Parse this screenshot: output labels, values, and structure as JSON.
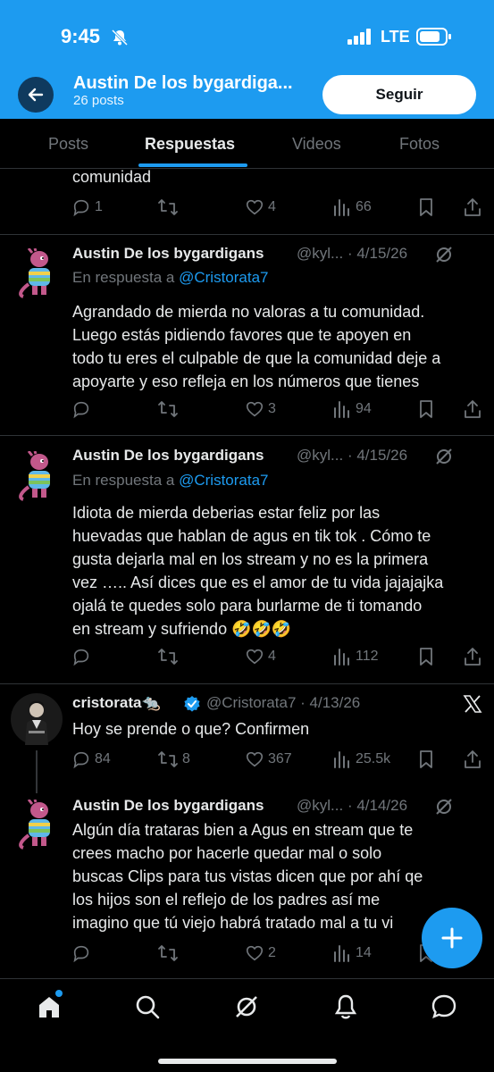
{
  "status_bar": {
    "time": "9:45",
    "network": "LTE"
  },
  "profile": {
    "name": "Austin De los bygardiga...",
    "posts": "26 posts",
    "follow_label": "Seguir"
  },
  "tabs": [
    {
      "label": "Posts"
    },
    {
      "label": "Respuestas",
      "active": true
    },
    {
      "label": "Videos"
    },
    {
      "label": "Fotos"
    }
  ],
  "partial_post": {
    "text": "comunidad",
    "replies": "1",
    "likes": "4",
    "views": "66"
  },
  "posts": [
    {
      "name": "Austin De los bygardigans",
      "handle": "@kyl...",
      "date": "· 4/15/26",
      "reply_prefix": "En respuesta a",
      "reply_to": "@Cristorata7",
      "lines": [
        "Agrandado de mierda no valoras a tu comunidad.",
        "Luego estás pidiendo favores que te apoyen en",
        "todo tu eres el culpable de que la comunidad deje a",
        "apoyarte y eso refleja en los números que tienes"
      ],
      "replies": "",
      "reposts": "",
      "likes": "3",
      "views": "94"
    },
    {
      "name": "Austin De los bygardigans",
      "handle": "@kyl...",
      "date": "· 4/15/26",
      "reply_prefix": "En respuesta a",
      "reply_to": "@Cristorata7",
      "lines": [
        "Idiota de mierda deberias estar feliz por las",
        "huevadas que hablan de agus en tik tok . Cómo te",
        "gusta dejarla mal en los stream y no es la primera",
        "vez ….. Así dices que es el amor de tu vida jajajajka",
        "ojalá te quedes solo para burlarme de ti tomando",
        "en stream y sufriendo 🤣🤣🤣"
      ],
      "replies": "",
      "reposts": "",
      "likes": "4",
      "views": "112"
    },
    {
      "name": "cristorata🐀",
      "handle": "@Cristorata7",
      "date": "· 4/13/26",
      "lines": [
        "Hoy se prende o que? Confirmen"
      ],
      "replies": "84",
      "reposts": "8",
      "likes": "367",
      "views": "25.5k"
    },
    {
      "name": "Austin De los bygardigans",
      "handle": "@kyl...",
      "date": "· 4/14/26",
      "lines": [
        "Algún día trataras bien a Agus en stream que te",
        "crees macho por hacerle quedar mal o solo",
        "buscas Clips para tus vistas dicen que por ahí qe",
        "los hijos son el reflejo de los padres así me",
        "imagino que tú viejo habrá tratado mal a tu vi"
      ],
      "replies": "",
      "reposts": "",
      "likes": "2",
      "views": "14"
    }
  ],
  "colors": {
    "accent": "#1d9bf0",
    "background": "#000000",
    "muted": "#71767b",
    "text": "#e7e9ea"
  }
}
